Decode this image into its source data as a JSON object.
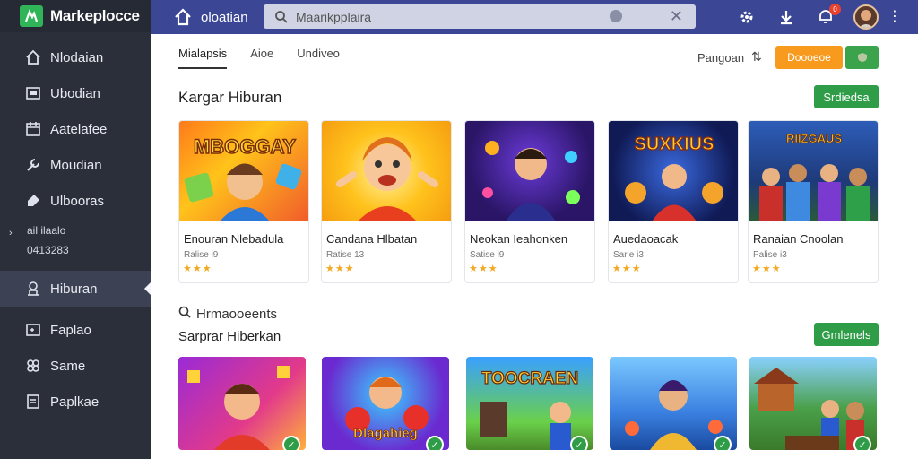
{
  "app": {
    "name": "Markeplocce"
  },
  "sidebar": {
    "items": [
      {
        "label": "Nlodaian",
        "icon": "home-icon"
      },
      {
        "label": "Ubodian",
        "icon": "monitor-icon"
      },
      {
        "label": "Aatelafee",
        "icon": "calendar-icon"
      },
      {
        "label": "Moudian",
        "icon": "wrench-icon"
      },
      {
        "label": "Ulbooras",
        "icon": "tag-icon"
      }
    ],
    "sub": {
      "line1": "ail ilaalo",
      "line2": "0413283"
    },
    "active_item": {
      "label": "Hiburan",
      "icon": "person-icon"
    },
    "bottom_items": [
      {
        "label": "Faplao",
        "icon": "gamepad-icon"
      },
      {
        "label": "Same",
        "icon": "puzzle-icon"
      },
      {
        "label": "Paplkae",
        "icon": "document-icon"
      }
    ]
  },
  "topbar": {
    "title": "oloatian",
    "search_placeholder": "Maarikpplaira",
    "notification_count": "0"
  },
  "tabs": [
    {
      "label": "Mialapsis",
      "active": true
    },
    {
      "label": "Aioe",
      "active": false
    },
    {
      "label": "Undiveo",
      "active": false
    }
  ],
  "filter": {
    "label": "Pangoan",
    "icon": "sort-icon"
  },
  "header_button": "Doooeoe",
  "section1": {
    "title": "Kargar Hiburan",
    "button": "Srdiedsa",
    "cards": [
      {
        "name": "Enouran Nlebadula",
        "rating": "Ralise i9",
        "stars": "★★★"
      },
      {
        "name": "Candana Hlbatan",
        "rating": "Ratise 13",
        "stars": "★★★"
      },
      {
        "name": "Neokan Ieahonken",
        "rating": "Satise i9",
        "stars": "★★★"
      },
      {
        "name": "Auedaoacak",
        "rating": "Sarie i3",
        "stars": "★★★"
      },
      {
        "name": "Ranaian Cnoolan",
        "rating": "Palise i3",
        "stars": "★★★"
      }
    ]
  },
  "recommend": {
    "label": "Hrmaooeents"
  },
  "section2": {
    "title": "Sarprar Hiberkan",
    "button": "Gmlenels",
    "cards": [
      {
        "caption": ""
      },
      {
        "caption": "Dlagahieg"
      },
      {
        "caption": "TOOCRAEN"
      },
      {
        "caption": ""
      },
      {
        "caption": ""
      }
    ]
  },
  "thumb_titles": [
    "MBOGGAY",
    "",
    "",
    "SUXKIUS",
    "RIIZGAUS"
  ],
  "colors": {
    "sidebar": "#2b2f3a",
    "topbar": "#3b4794",
    "accent_green": "#2f9d47",
    "accent_orange": "#f79a1e",
    "star": "#f3a821"
  }
}
